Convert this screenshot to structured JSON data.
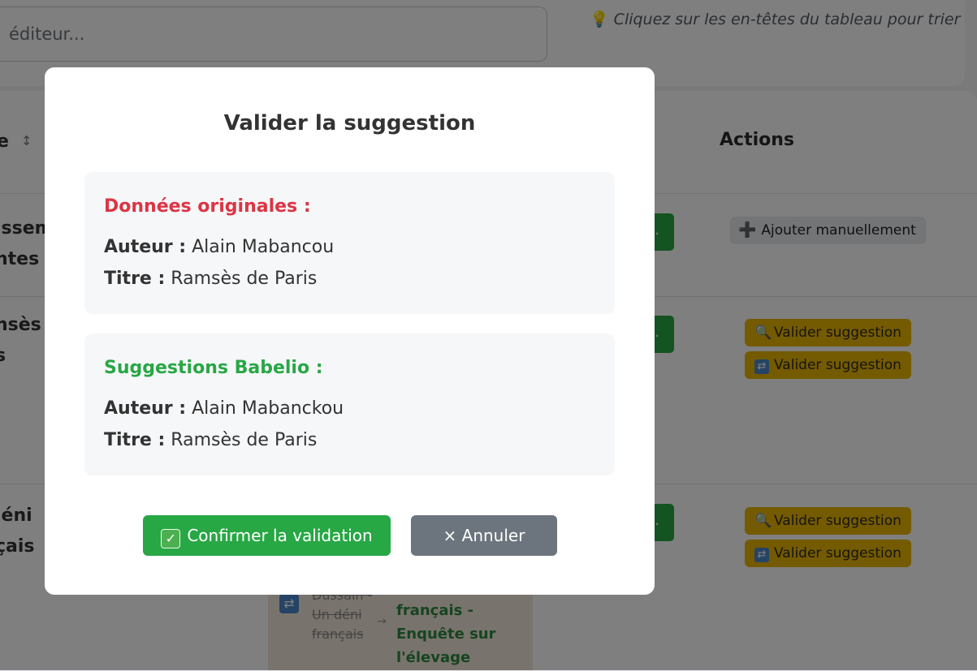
{
  "search": {
    "placeholder": "éditeur..."
  },
  "hint": {
    "icon": "lightbulb-icon",
    "text": "Cliquez sur les en-têtes du tableau pour trier"
  },
  "table": {
    "header_fragment": "e",
    "sort_glyph": "↕",
    "actions_header": "Actions",
    "rows": [
      {
        "lines": [
          "isseme",
          "ntes"
        ]
      },
      {
        "lines": [
          "nsès d",
          "s"
        ]
      },
      {
        "lines": [
          "léni",
          "çais"
        ]
      }
    ],
    "add_manual_label": "Ajouter manuellement",
    "validate_label": "Valider suggestion",
    "suggestion_cell": {
      "old_text": "Dussain - Un déni français",
      "new_text": "français - Enquête sur l'élevage"
    }
  },
  "modal": {
    "title": "Valider la suggestion",
    "original": {
      "heading": "Données originales :",
      "author_label": "Auteur :",
      "author": "Alain Mabancou",
      "title_label": "Titre :",
      "title": "Ramsès de Paris"
    },
    "suggestion": {
      "heading": "Suggestions Babelio :",
      "author_label": "Auteur :",
      "author": "Alain Mabanckou",
      "title_label": "Titre :",
      "title": "Ramsès de Paris"
    },
    "confirm_label": "Confirmer la validation",
    "cancel_label": "× Annuler"
  },
  "colors": {
    "confirm": "#28a745",
    "cancel": "#6c757d",
    "original_heading": "#dc3545",
    "suggestion_heading": "#28a745",
    "validate_button": "#e8b400"
  }
}
